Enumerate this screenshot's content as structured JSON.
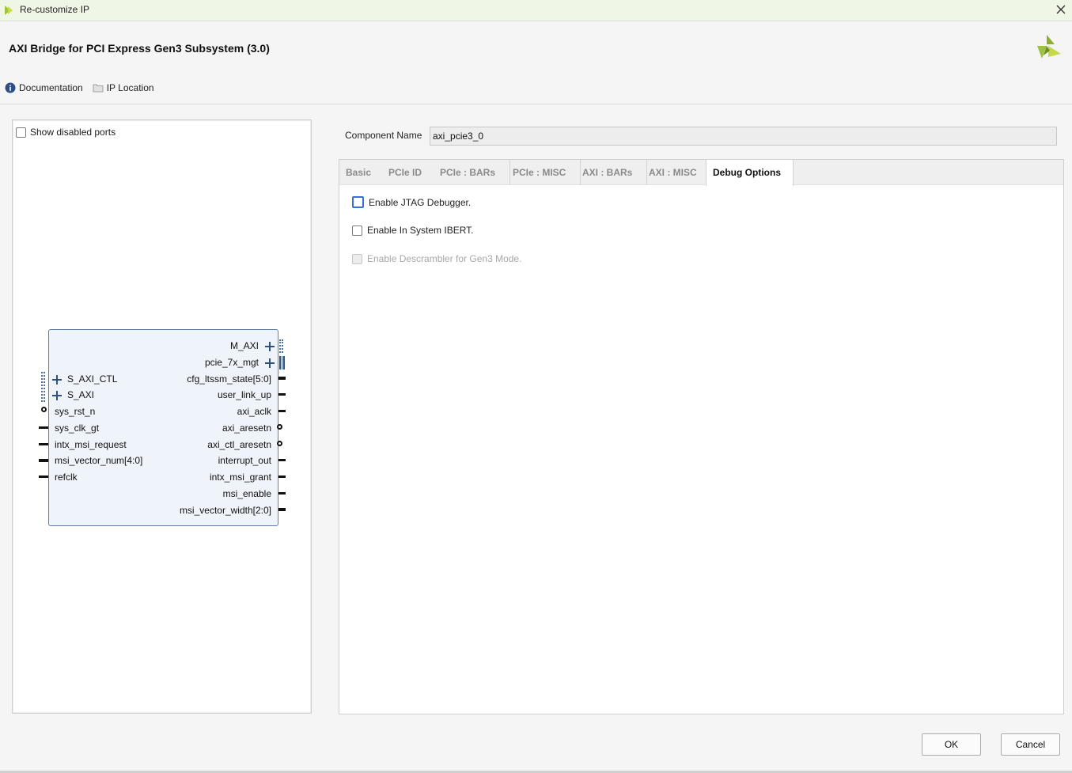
{
  "window": {
    "title": "Re-customize IP",
    "close_icon": "close-icon"
  },
  "header": {
    "ip_title": "AXI Bridge for PCI Express Gen3 Subsystem (3.0)",
    "logo_icon": "xilinx-logo-icon",
    "links": [
      {
        "label": "Documentation",
        "icon": "info-icon"
      },
      {
        "label": "IP Location",
        "icon": "folder-icon"
      }
    ]
  },
  "symbol_panel": {
    "show_disabled_label": "Show disabled ports",
    "show_disabled_checked": false,
    "left_ports": [
      "S_AXI_CTL",
      "S_AXI",
      "sys_rst_n",
      "sys_clk_gt",
      "intx_msi_request",
      "msi_vector_num[4:0]",
      "refclk"
    ],
    "right_ports": [
      "M_AXI",
      "pcie_7x_mgt",
      "cfg_ltssm_state[5:0]",
      "user_link_up",
      "axi_aclk",
      "axi_aresetn",
      "axi_ctl_aresetn",
      "interrupt_out",
      "intx_msi_grant",
      "msi_enable",
      "msi_vector_width[2:0]"
    ]
  },
  "component": {
    "label": "Component Name",
    "value": "axi_pcie3_0"
  },
  "tabs": [
    {
      "label": "Basic",
      "active": false
    },
    {
      "label": "PCIe ID",
      "active": false
    },
    {
      "label": "PCIe : BARs",
      "active": false
    },
    {
      "label": "PCIe : MISC",
      "active": false
    },
    {
      "label": "AXI : BARs",
      "active": false
    },
    {
      "label": "AXI : MISC",
      "active": false
    },
    {
      "label": "Debug Options",
      "active": true
    }
  ],
  "debug_options": [
    {
      "label": "Enable JTAG Debugger.",
      "checked": false,
      "enabled": true
    },
    {
      "label": "Enable In System IBERT.",
      "checked": false,
      "enabled": true
    },
    {
      "label": "Enable Descrambler for Gen3 Mode.",
      "checked": false,
      "enabled": false
    }
  ],
  "buttons": {
    "ok": "OK",
    "cancel": "Cancel"
  },
  "colors": {
    "title_bar": "#f0f6e6",
    "xilinx_green": "#9bc33b",
    "block_fill": "#eef4fa",
    "block_border": "#5b7fa8"
  }
}
